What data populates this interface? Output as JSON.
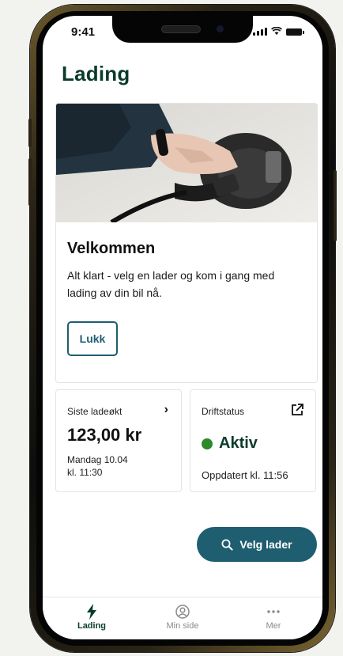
{
  "status_bar": {
    "time": "9:41"
  },
  "header": {
    "title": "Lading"
  },
  "welcome": {
    "title": "Velkommen",
    "text": "Alt klart - velg en lader og kom i gang med lading av din bil nå.",
    "close_label": "Lukk"
  },
  "last_session": {
    "label": "Siste ladeøkt",
    "amount": "123,00 kr",
    "date_line1": "Mandag 10.04",
    "date_line2": "kl. 11:30"
  },
  "operation_status": {
    "label": "Driftstatus",
    "value": "Aktiv",
    "updated": "Oppdatert kl. 11:56",
    "status_color": "#2d8a2a"
  },
  "fab": {
    "label": "Velg lader",
    "icon": "search-icon"
  },
  "tabs": [
    {
      "label": "Lading",
      "icon": "lightning-icon",
      "active": true
    },
    {
      "label": "Min side",
      "icon": "user-circle-icon",
      "active": false
    },
    {
      "label": "Mer",
      "icon": "more-dots-icon",
      "active": false
    }
  ],
  "colors": {
    "brand_dark": "#0b3b2a",
    "accent": "#1f5e70",
    "status_green": "#2d8a2a"
  }
}
